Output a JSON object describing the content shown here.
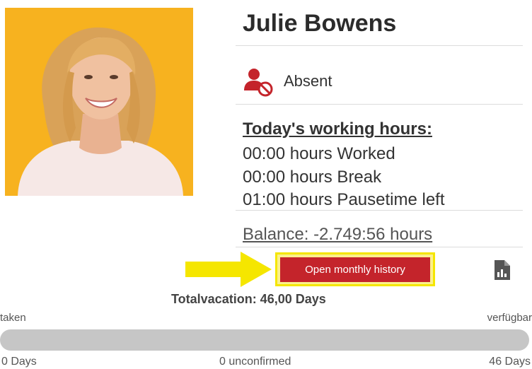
{
  "profile": {
    "name": "Julie Bowens",
    "photo_bg": "#f7b21f"
  },
  "status": {
    "label": "Absent",
    "icon": "user-absent-icon",
    "color": "#c4242b"
  },
  "working_hours": {
    "title": "Today's working hours:",
    "lines": [
      "00:00 hours Worked",
      "00:00 hours Break",
      "01:00 hours Pausetime left"
    ]
  },
  "balance": "Balance: -2.749:56 hours",
  "actions": {
    "monthly_history_label": "Open monthly history",
    "button_color": "#c4242b",
    "highlight_color": "#f5e600",
    "report_icon": "report-chart-icon"
  },
  "vacation": {
    "total": "Totalvacation: 46,00 Days",
    "taken_label": "taken",
    "available_label": "verfügbar",
    "taken_days": "0 Days",
    "unconfirmed": "0 unconfirmed",
    "available_days": "46 Days",
    "taken_fraction": 0
  }
}
